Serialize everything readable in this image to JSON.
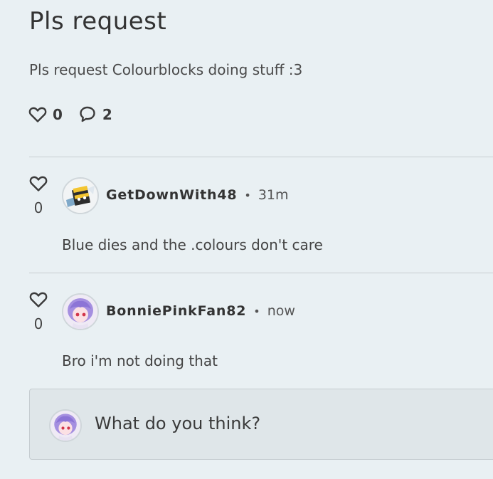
{
  "post": {
    "title": "Pls request",
    "body": "Pls request Colourblocks doing stuff :3",
    "likes": "0",
    "comments_count": "2"
  },
  "comments": [
    {
      "likes": "0",
      "username": "GetDownWith48",
      "separator": "•",
      "time": "31m",
      "text": "Blue dies and the .colours don't care"
    },
    {
      "likes": "0",
      "username": "BonniePinkFan82",
      "separator": "•",
      "time": "now",
      "text": "Bro i'm not doing that"
    }
  ],
  "composer": {
    "placeholder": "What do you think?"
  },
  "icons": {
    "like": "heart-icon",
    "comment": "comment-bubble-icon"
  },
  "colors": {
    "background": "#e9f0f3",
    "composer_background": "#dfe6e9",
    "divider": "#c8cdd0"
  }
}
